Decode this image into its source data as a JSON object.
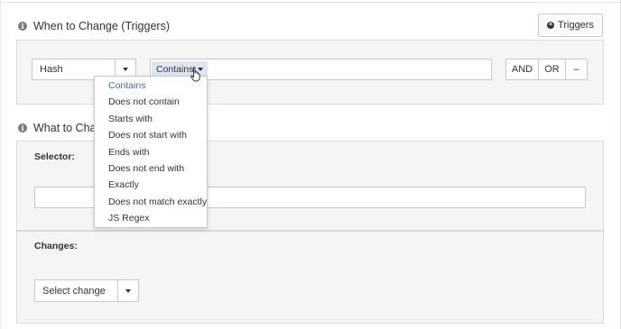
{
  "triggers_section": {
    "title": "When to Change (Triggers)",
    "triggers_button": "Triggers",
    "type_select": {
      "value": "Hash"
    },
    "condition_chip": {
      "value": "Contains"
    },
    "logic_buttons": {
      "and": "AND",
      "or": "OR",
      "remove": "–"
    }
  },
  "condition_dropdown": {
    "items": [
      "Contains",
      "Does not contain",
      "Starts with",
      "Does not start with",
      "Ends with",
      "Does not end with",
      "Exactly",
      "Does not match exactly",
      "JS Regex"
    ],
    "selected": "Contains"
  },
  "what_section": {
    "title_visible": "What to Chan",
    "selector_label": "Selector:",
    "changes_label": "Changes:",
    "change_select": {
      "value": "Select change"
    }
  },
  "colors": {
    "accent": "#3a6fb0",
    "chip_bg": "#dce6f2",
    "panel_bg": "#f5f5f5"
  }
}
